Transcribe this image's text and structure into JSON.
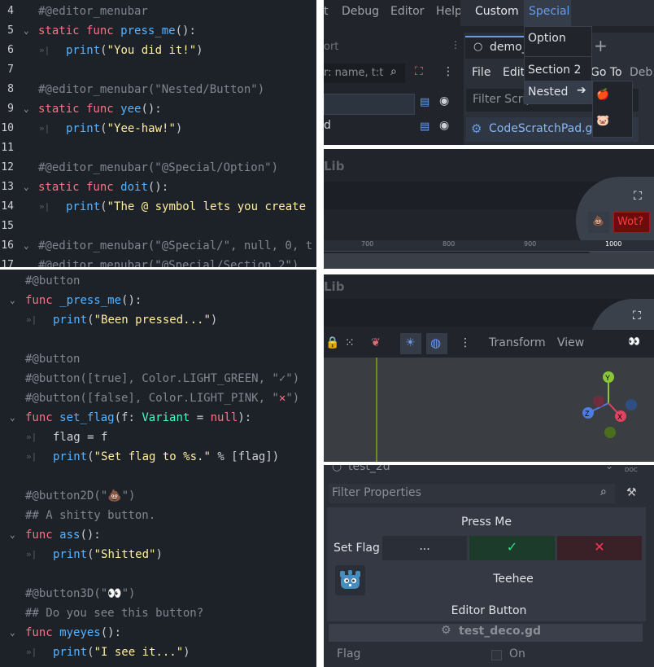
{
  "code_top": {
    "lines": [
      {
        "n": "4",
        "fold": false,
        "indent": false,
        "parts": [
          {
            "c": "k-comment",
            "t": "#@editor_menubar"
          }
        ]
      },
      {
        "n": "5",
        "fold": true,
        "indent": false,
        "parts": [
          {
            "c": "k-kw",
            "t": "static func "
          },
          {
            "c": "k-fn",
            "t": "press_me"
          },
          {
            "c": "k-plain",
            "t": "():"
          }
        ]
      },
      {
        "n": "6",
        "fold": false,
        "indent": true,
        "parts": [
          {
            "c": "k-fn",
            "t": "print"
          },
          {
            "c": "k-plain",
            "t": "("
          },
          {
            "c": "k-str",
            "t": "\"You did it!\""
          },
          {
            "c": "k-plain",
            "t": ")"
          }
        ]
      },
      {
        "n": "7",
        "fold": false,
        "indent": false,
        "parts": []
      },
      {
        "n": "8",
        "fold": false,
        "indent": false,
        "parts": [
          {
            "c": "k-comment",
            "t": "#@editor_menubar(\"Nested/Button\")"
          }
        ]
      },
      {
        "n": "9",
        "fold": true,
        "indent": false,
        "parts": [
          {
            "c": "k-kw",
            "t": "static func "
          },
          {
            "c": "k-fn",
            "t": "yee"
          },
          {
            "c": "k-plain",
            "t": "():"
          }
        ]
      },
      {
        "n": "10",
        "fold": false,
        "indent": true,
        "parts": [
          {
            "c": "k-fn",
            "t": "print"
          },
          {
            "c": "k-plain",
            "t": "("
          },
          {
            "c": "k-str",
            "t": "\"Yee-haw!\""
          },
          {
            "c": "k-plain",
            "t": ")"
          }
        ]
      },
      {
        "n": "11",
        "fold": false,
        "indent": false,
        "parts": []
      },
      {
        "n": "12",
        "fold": false,
        "indent": false,
        "parts": [
          {
            "c": "k-comment",
            "t": "#@editor_menubar(\"@Special/Option\")"
          }
        ]
      },
      {
        "n": "13",
        "fold": true,
        "indent": false,
        "parts": [
          {
            "c": "k-kw",
            "t": "static func "
          },
          {
            "c": "k-fn",
            "t": "doit"
          },
          {
            "c": "k-plain",
            "t": "():"
          }
        ]
      },
      {
        "n": "14",
        "fold": false,
        "indent": true,
        "parts": [
          {
            "c": "k-fn",
            "t": "print"
          },
          {
            "c": "k-plain",
            "t": "("
          },
          {
            "c": "k-str",
            "t": "\"The @ symbol lets you create"
          }
        ]
      },
      {
        "n": "15",
        "fold": false,
        "indent": false,
        "parts": []
      },
      {
        "n": "16",
        "fold": true,
        "indent": false,
        "parts": [
          {
            "c": "k-comment",
            "t": "#@editor_menubar(\"@Special/\", null, 0, t"
          }
        ]
      },
      {
        "n": "17",
        "fold": false,
        "indent": false,
        "parts": [
          {
            "c": "k-comment",
            "t": "#@editor_menubar(\"@Special/Section 2\")"
          }
        ]
      }
    ]
  },
  "code_bottom": {
    "lines": [
      {
        "fold": false,
        "indent": false,
        "parts": [
          {
            "c": "k-comment",
            "t": "#@button"
          }
        ]
      },
      {
        "fold": true,
        "indent": false,
        "parts": [
          {
            "c": "k-kw",
            "t": "func "
          },
          {
            "c": "k-fn",
            "t": "_press_me"
          },
          {
            "c": "k-plain",
            "t": "():"
          }
        ]
      },
      {
        "fold": false,
        "indent": true,
        "parts": [
          {
            "c": "k-fn",
            "t": "print"
          },
          {
            "c": "k-plain",
            "t": "("
          },
          {
            "c": "k-str",
            "t": "\"Been pressed...\""
          },
          {
            "c": "k-plain",
            "t": ")"
          }
        ]
      },
      {
        "fold": false,
        "indent": false,
        "parts": []
      },
      {
        "fold": false,
        "indent": false,
        "parts": [
          {
            "c": "k-comment",
            "t": "#@button"
          }
        ]
      },
      {
        "fold": false,
        "indent": false,
        "parts": [
          {
            "c": "k-comment",
            "t": "#@button([true], Color.LIGHT_GREEN, \"✓\")"
          }
        ]
      },
      {
        "fold": false,
        "indent": false,
        "parts": [
          {
            "c": "k-comment",
            "t": "#@button([false], Color.LIGHT_PINK, \""
          },
          {
            "c": "k-kw",
            "t": "✕"
          },
          {
            "c": "k-comment",
            "t": "\")"
          }
        ]
      },
      {
        "fold": true,
        "indent": false,
        "parts": [
          {
            "c": "k-kw",
            "t": "func "
          },
          {
            "c": "k-fn",
            "t": "set_flag"
          },
          {
            "c": "k-plain",
            "t": "(f: "
          },
          {
            "c": "k-type",
            "t": "Variant"
          },
          {
            "c": "k-plain",
            "t": " = "
          },
          {
            "c": "k-kw",
            "t": "null"
          },
          {
            "c": "k-plain",
            "t": "):"
          }
        ]
      },
      {
        "fold": false,
        "indent": true,
        "parts": [
          {
            "c": "k-plain",
            "t": "flag = f"
          }
        ]
      },
      {
        "fold": false,
        "indent": true,
        "parts": [
          {
            "c": "k-fn",
            "t": "print"
          },
          {
            "c": "k-plain",
            "t": "("
          },
          {
            "c": "k-str",
            "t": "\"Set flag to %s.\""
          },
          {
            "c": "k-plain",
            "t": " % [flag])"
          }
        ]
      },
      {
        "fold": false,
        "indent": false,
        "parts": []
      },
      {
        "fold": false,
        "indent": false,
        "parts": [
          {
            "c": "k-comment",
            "t": "#@button2D(\"💩\")"
          }
        ]
      },
      {
        "fold": false,
        "indent": false,
        "parts": [
          {
            "c": "k-comment",
            "t": "## A shitty button."
          }
        ]
      },
      {
        "fold": true,
        "indent": false,
        "parts": [
          {
            "c": "k-kw",
            "t": "func "
          },
          {
            "c": "k-fn",
            "t": "ass"
          },
          {
            "c": "k-plain",
            "t": "():"
          }
        ]
      },
      {
        "fold": false,
        "indent": true,
        "parts": [
          {
            "c": "k-fn",
            "t": "print"
          },
          {
            "c": "k-plain",
            "t": "("
          },
          {
            "c": "k-str",
            "t": "\"Shitted\""
          },
          {
            "c": "k-plain",
            "t": ")"
          }
        ]
      },
      {
        "fold": false,
        "indent": false,
        "parts": []
      },
      {
        "fold": false,
        "indent": false,
        "parts": [
          {
            "c": "k-comment",
            "t": "#@button3D(\"👀\")"
          }
        ]
      },
      {
        "fold": false,
        "indent": false,
        "parts": [
          {
            "c": "k-comment",
            "t": "## Do you see this button?"
          }
        ]
      },
      {
        "fold": true,
        "indent": false,
        "parts": [
          {
            "c": "k-kw",
            "t": "func "
          },
          {
            "c": "k-fn",
            "t": "myeyes"
          },
          {
            "c": "k-plain",
            "t": "():"
          }
        ]
      },
      {
        "fold": false,
        "indent": true,
        "parts": [
          {
            "c": "k-fn",
            "t": "print"
          },
          {
            "c": "k-plain",
            "t": "("
          },
          {
            "c": "k-str",
            "t": "\"I see it...\""
          },
          {
            "c": "k-plain",
            "t": ")"
          }
        ]
      }
    ]
  },
  "menus": {
    "menubar": [
      "t",
      "Debug",
      "Editor",
      "Help",
      "Custom",
      "Special"
    ],
    "special_items": [
      "Option",
      "Section 2",
      "Nested"
    ],
    "nested_emojis": [
      "🍎",
      "🐷"
    ],
    "script_tab": "demo_",
    "script_menu": [
      "File",
      "Edit",
      "Go To",
      "Deb"
    ],
    "filter_scripts": "Filter Scrip",
    "script_file": "CodeScratchPad.gc",
    "scene_filter": "r: name, t:t",
    "scene_row": "d",
    "port_label": "ort"
  },
  "panel2d": {
    "title": "Lib",
    "button_emoji": "💩",
    "button_label": "Wot?",
    "ruler_ticks": [
      "700",
      "800",
      "900",
      "1000"
    ]
  },
  "panel3d": {
    "title": "Lib",
    "toolbar": [
      "Transform",
      "View"
    ],
    "eyes_emoji": "👀",
    "gizmo_axes": [
      "Y",
      "Z",
      "X"
    ]
  },
  "inspector": {
    "node_name": "test_2d",
    "filter_placeholder": "Filter Properties",
    "press_me": "Press Me",
    "set_flag": "Set Flag",
    "ellipsis": "...",
    "check": "✓",
    "cross": "✕",
    "teehee": "Teehee",
    "editor_button": "Editor Button",
    "script_name": "test_deco.gd",
    "flag_label": "Flag",
    "flag_value": "On",
    "doc_label": "DOC"
  },
  "colors": {
    "code_bg": "#1d2229",
    "keyword": "#ff7085",
    "function": "#57b3ff",
    "string": "#ffeda1",
    "comment": "#808690",
    "accent": "#699ce8",
    "green_btn": "#1d3b2a",
    "red_btn": "#3a2027",
    "wot_red": "#6b0d0d"
  }
}
